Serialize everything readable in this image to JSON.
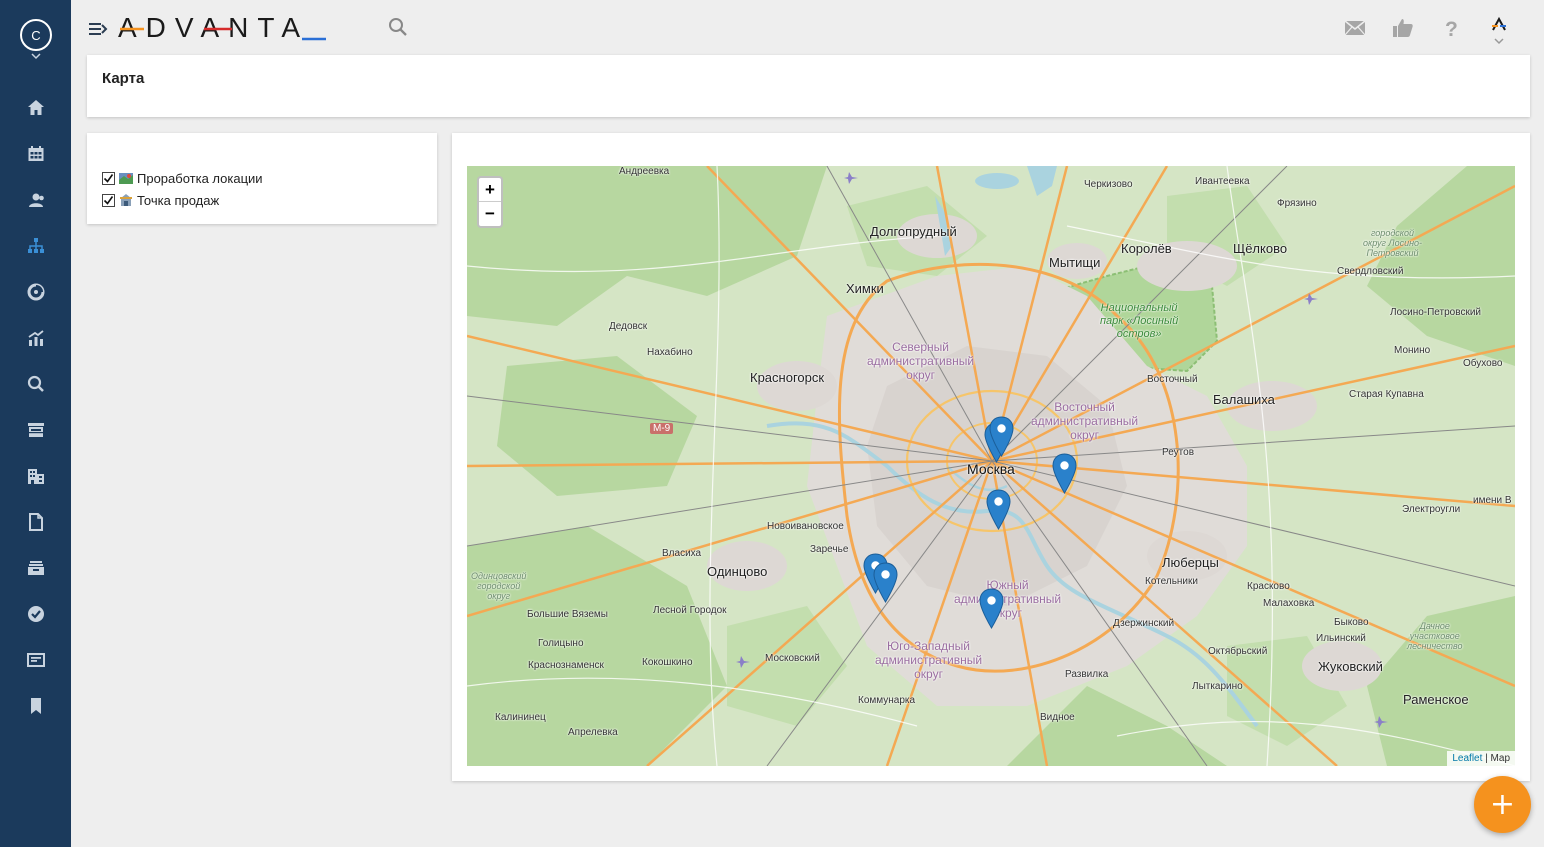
{
  "header": {
    "logo_text": "ADVANTA",
    "user_initial": "C",
    "icons": [
      "menu-toggle-icon",
      "search-icon",
      "mail-icon",
      "thumbs-up-icon",
      "help-icon",
      "user-menu-icon"
    ]
  },
  "sidebar": {
    "items": [
      {
        "name": "home-icon"
      },
      {
        "name": "calendar-icon"
      },
      {
        "name": "users-icon"
      },
      {
        "name": "hierarchy-icon",
        "active": true
      },
      {
        "name": "dashboard-icon"
      },
      {
        "name": "analytics-icon"
      },
      {
        "name": "search-icon"
      },
      {
        "name": "inbox-icon"
      },
      {
        "name": "buildings-icon"
      },
      {
        "name": "document-icon"
      },
      {
        "name": "archive-icon"
      },
      {
        "name": "check-circle-icon"
      },
      {
        "name": "news-icon"
      },
      {
        "name": "bookmark-icon"
      }
    ]
  },
  "page": {
    "title": "Карта"
  },
  "layers": [
    {
      "label": "Проработка локации",
      "checked": true,
      "icon": "location-research-icon"
    },
    {
      "label": "Точка продаж",
      "checked": true,
      "icon": "sales-point-icon"
    }
  ],
  "map": {
    "zoom_in": "+",
    "zoom_out": "−",
    "attribution_link": "Leaflet",
    "attribution_sep": " | ",
    "attribution_rest": "Map",
    "labels": {
      "andreevka": "Андреевка",
      "cherkizovo": "Черкизово",
      "ivanteevka": "Ивантеевка",
      "fryazino": "Фрязино",
      "dolgoprudny": "Долгопрудный",
      "korolev": "Королёв",
      "shchelkovo": "Щёлково",
      "losino_okrug": "городской\nокруг Лосино-\nПетровский",
      "mytishchi": "Мытищи",
      "sverdlovsky": "Свердловский",
      "khimki": "Химки",
      "nat_park": "Национальный\nпарк «Лосиный\nостров»",
      "dedovsk": "Дедовск",
      "losino_petrovsky": "Лосино-Петровский",
      "nakhabino": "Нахабино",
      "severny": "Северный\nадминистративный\nокруг",
      "monino": "Монино",
      "obukhovo": "Обухово",
      "krasnogorsk": "Красногорск",
      "vostochny_town": "Восточный",
      "balashikha": "Балашиха",
      "staraya_kupavna": "Старая Купавна",
      "vostochny": "Восточный\nадминистративный\nокруг",
      "m9": "М-9",
      "moskva": "Москва",
      "reutov": "Реутов",
      "imeni_v": "имени В",
      "elektrougli": "Электроугли",
      "novoivanovskoe": "Новоивановское",
      "zarechye": "Заречье",
      "vlasikha": "Власиха",
      "lyubertsy": "Люберцы",
      "odintsovo": "Одинцово",
      "kotelniki": "Котельники",
      "kraskovo": "Красково",
      "odintsovo_okrug": "Одинцовский\nгородской\nокруг",
      "yuzhny": "Южный\nадминистративный\nокруг",
      "malakhovka": "Малаховка",
      "bolshie_vyazemy": "Большие\nВяземы",
      "lesnoy_gorodok": "Лесной Городок",
      "dzerzhinsky": "Дзержинский",
      "bykovo": "Быково",
      "golitsyno": "Голицыно",
      "ilyinsky": "Ильинский",
      "dachnoe": "Дачное\nучастковое\nлесничество",
      "yugo_zapadny": "Юго-Западный\nадминистративный\nокруг",
      "oktyabrsky": "Октябрьский",
      "krasnoznamensk": "Краснознаменск",
      "kokoshkino": "Кокошкино",
      "moskovsky": "Московский",
      "zhukovsky": "Жуковский",
      "razvilka": "Развилка",
      "lytkarino": "Лыткарино",
      "ramenskoe": "Раменское",
      "kommunarka": "Коммунарка",
      "kalininets": "Калининец",
      "vidnoe": "Видное",
      "aprelevka": "Апрелевка"
    }
  },
  "colors": {
    "sidebar_bg": "#1b3a5c",
    "active_icon": "#3a8fd6",
    "marker": "#2a81cb",
    "fab": "#f5921e",
    "logo_accent_orange": "#f5921e",
    "logo_accent_red": "#d62b2b",
    "logo_accent_blue": "#2a6fd6"
  },
  "fab": {
    "label": "+"
  }
}
